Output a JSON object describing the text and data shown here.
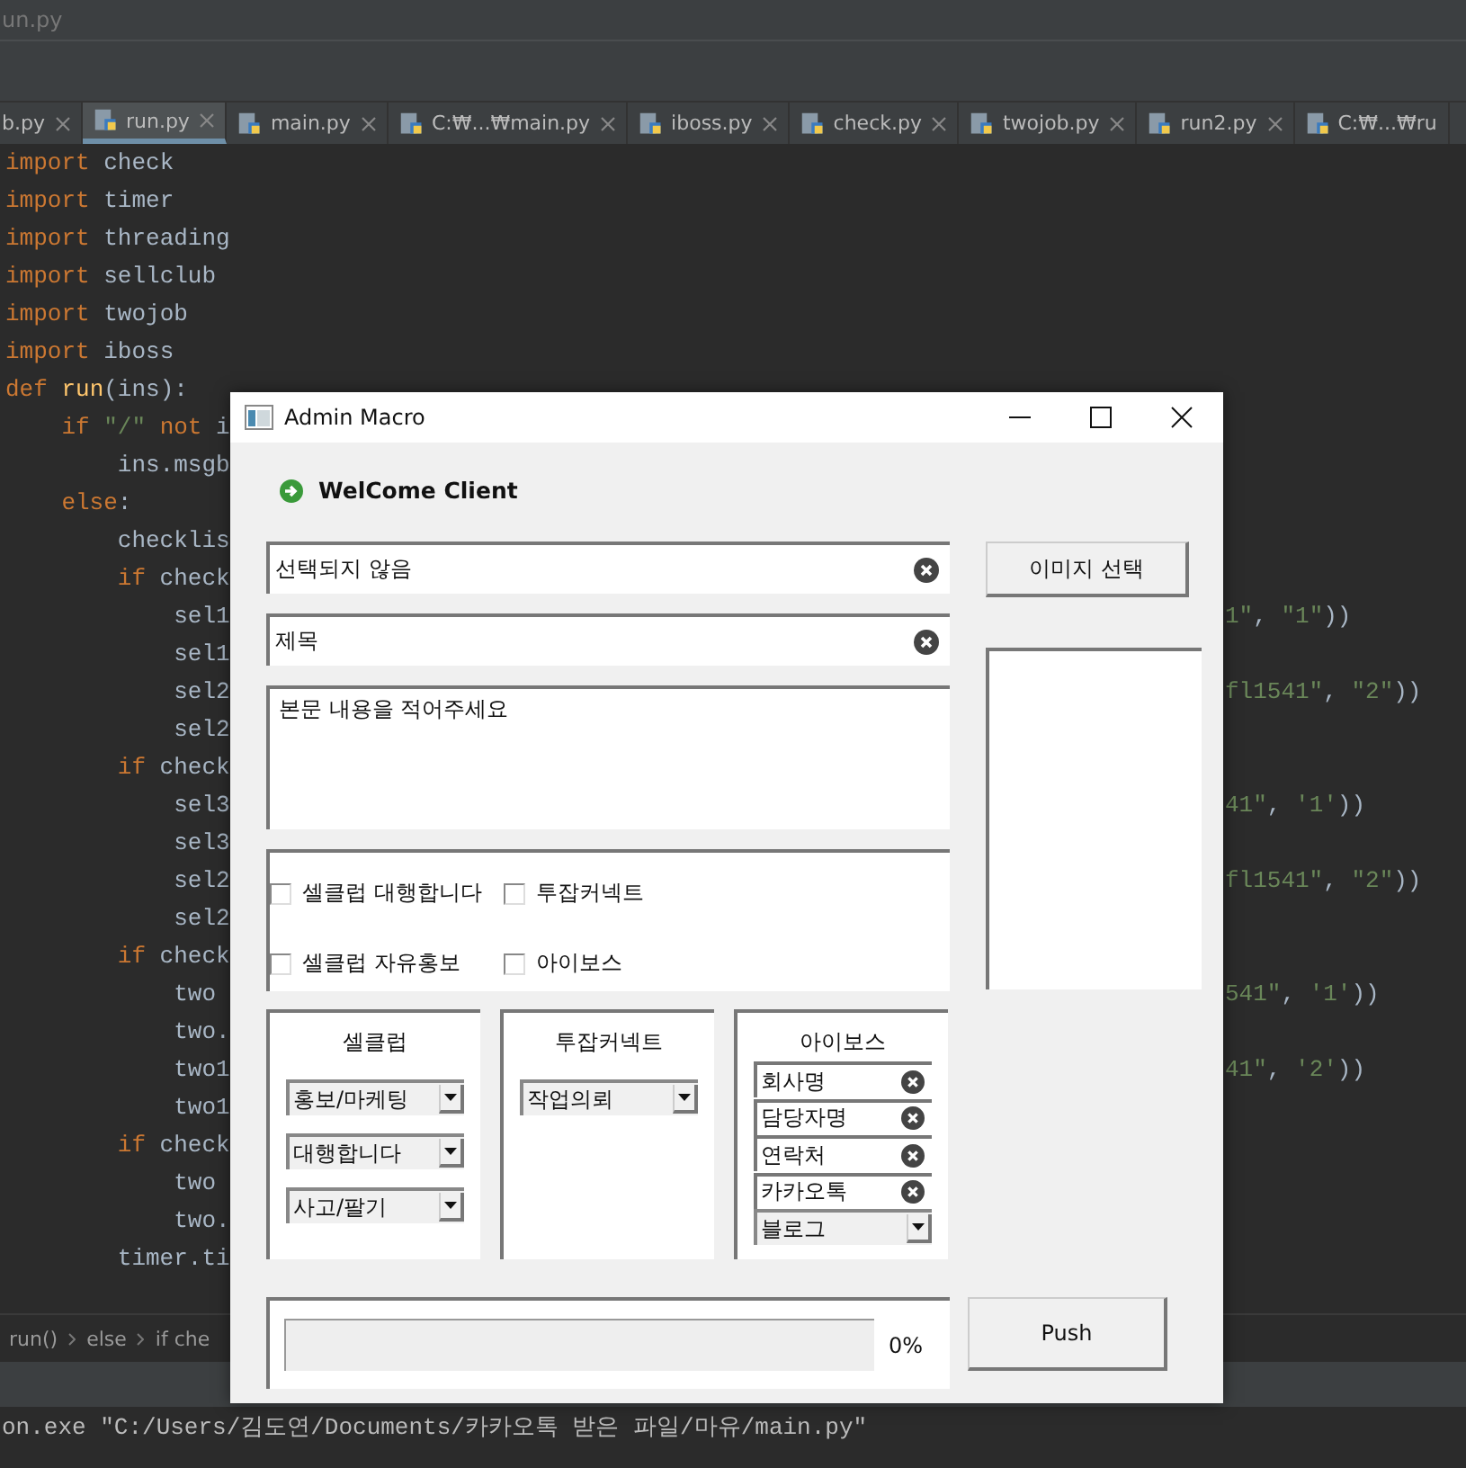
{
  "ide": {
    "title": "un.py",
    "tabs": [
      {
        "label": "b.py",
        "selected": false,
        "closable": true
      },
      {
        "label": "run.py",
        "selected": true,
        "closable": true
      },
      {
        "label": "main.py",
        "selected": false,
        "closable": true
      },
      {
        "label": "C:₩...₩main.py",
        "selected": false,
        "closable": true
      },
      {
        "label": "iboss.py",
        "selected": false,
        "closable": true
      },
      {
        "label": "check.py",
        "selected": false,
        "closable": true
      },
      {
        "label": "twojob.py",
        "selected": false,
        "closable": true
      },
      {
        "label": "run2.py",
        "selected": false,
        "closable": true
      },
      {
        "label": "C:₩...₩ru",
        "selected": false,
        "closable": false
      }
    ],
    "code": [
      {
        "left": [
          {
            "kind": "kw",
            "text": "import "
          },
          {
            "kind": "plain",
            "text": "check"
          }
        ]
      },
      {
        "left": [
          {
            "kind": "kw",
            "text": "import "
          },
          {
            "kind": "plain",
            "text": "timer"
          }
        ]
      },
      {
        "left": [
          {
            "kind": "kw",
            "text": "import "
          },
          {
            "kind": "plain",
            "text": "threading"
          }
        ]
      },
      {
        "left": [
          {
            "kind": "kw",
            "text": "import "
          },
          {
            "kind": "plain",
            "text": "sellclub"
          }
        ]
      },
      {
        "left": [
          {
            "kind": "kw",
            "text": "import "
          },
          {
            "kind": "plain",
            "text": "twojob"
          }
        ]
      },
      {
        "left": [
          {
            "kind": "kw",
            "text": "import "
          },
          {
            "kind": "plain",
            "text": "iboss"
          }
        ]
      },
      {
        "left": [
          {
            "kind": "kw",
            "text": "def "
          },
          {
            "kind": "fn",
            "text": "run"
          },
          {
            "kind": "plain",
            "text": "(ins):"
          }
        ]
      },
      {
        "left": [
          {
            "kind": "kw",
            "text": "    if "
          },
          {
            "kind": "str",
            "text": "\"/\" "
          },
          {
            "kind": "kw",
            "text": "not "
          },
          {
            "kind": "plain",
            "text": "i"
          }
        ]
      },
      {
        "left": [
          {
            "kind": "plain",
            "text": "        ins.msgb"
          }
        ]
      },
      {
        "left": [
          {
            "kind": "kw",
            "text": "    else"
          },
          {
            "kind": "plain",
            "text": ":"
          }
        ]
      },
      {
        "left": [
          {
            "kind": "plain",
            "text": "        checklis"
          }
        ]
      },
      {
        "left": [
          {
            "kind": "kw",
            "text": "        if "
          },
          {
            "kind": "plain",
            "text": "check"
          }
        ]
      },
      {
        "left": [
          {
            "kind": "plain",
            "text": "            sel1"
          }
        ],
        "right": [
          {
            "kind": "str",
            "text": "1\""
          },
          {
            "kind": "plain",
            "text": ", "
          },
          {
            "kind": "str",
            "text": "\"1\""
          },
          {
            "kind": "plain",
            "text": "))"
          }
        ]
      },
      {
        "left": [
          {
            "kind": "plain",
            "text": "            sel1"
          }
        ]
      },
      {
        "left": [
          {
            "kind": "plain",
            "text": "            sel2"
          }
        ],
        "right": [
          {
            "kind": "str",
            "text": "fl1541\""
          },
          {
            "kind": "plain",
            "text": ", "
          },
          {
            "kind": "str",
            "text": "\"2\""
          },
          {
            "kind": "plain",
            "text": "))"
          }
        ]
      },
      {
        "left": [
          {
            "kind": "plain",
            "text": "            sel2"
          }
        ]
      },
      {
        "left": [
          {
            "kind": "kw",
            "text": "        if "
          },
          {
            "kind": "plain",
            "text": "check"
          }
        ]
      },
      {
        "left": [
          {
            "kind": "plain",
            "text": "            sel3"
          }
        ],
        "right": [
          {
            "kind": "str",
            "text": "41\""
          },
          {
            "kind": "plain",
            "text": ", "
          },
          {
            "kind": "str",
            "text": "'1'"
          },
          {
            "kind": "plain",
            "text": "))"
          }
        ]
      },
      {
        "left": [
          {
            "kind": "plain",
            "text": "            sel3"
          }
        ]
      },
      {
        "left": [
          {
            "kind": "plain",
            "text": "            sel2"
          }
        ],
        "right": [
          {
            "kind": "str",
            "text": "fl1541\""
          },
          {
            "kind": "plain",
            "text": ", "
          },
          {
            "kind": "str",
            "text": "\"2\""
          },
          {
            "kind": "plain",
            "text": "))"
          }
        ]
      },
      {
        "left": [
          {
            "kind": "plain",
            "text": "            sel2"
          }
        ]
      },
      {
        "left": [
          {
            "kind": "kw",
            "text": "        if "
          },
          {
            "kind": "plain",
            "text": "check"
          }
        ]
      },
      {
        "left": [
          {
            "kind": "plain",
            "text": "            two"
          }
        ],
        "right": [
          {
            "kind": "str",
            "text": "541\""
          },
          {
            "kind": "plain",
            "text": ", "
          },
          {
            "kind": "str",
            "text": "'1'"
          },
          {
            "kind": "plain",
            "text": "))"
          }
        ]
      },
      {
        "left": [
          {
            "kind": "plain",
            "text": "            two."
          }
        ]
      },
      {
        "left": [
          {
            "kind": "plain",
            "text": "            two1"
          }
        ],
        "right": [
          {
            "kind": "str",
            "text": "41\""
          },
          {
            "kind": "plain",
            "text": ", "
          },
          {
            "kind": "str",
            "text": "'2'"
          },
          {
            "kind": "plain",
            "text": "))"
          }
        ]
      },
      {
        "left": [
          {
            "kind": "plain",
            "text": "            two1"
          }
        ]
      },
      {
        "left": [
          {
            "kind": "kw",
            "text": "        if "
          },
          {
            "kind": "plain",
            "text": "check"
          }
        ]
      },
      {
        "left": [
          {
            "kind": "plain",
            "text": "            two"
          }
        ]
      },
      {
        "left": [
          {
            "kind": "plain",
            "text": "            two."
          }
        ]
      },
      {
        "left": [
          {
            "kind": "plain",
            "text": "        timer.ti"
          }
        ]
      }
    ],
    "breadcrumb": [
      "run()",
      "else",
      "if che"
    ],
    "terminal": "on.exe \"C:/Users/김도연/Documents/카카오톡 받은 파일/마유/main.py\""
  },
  "dialog": {
    "title": "Admin Macro",
    "welcome": "WelCome Client",
    "file_field": {
      "value": "선택되지 않음"
    },
    "title_field": {
      "value": "제목"
    },
    "body_field": {
      "value": "본문 내용을 적어주세요"
    },
    "image_button": "이미지 선택",
    "checkboxes": [
      {
        "label": "셀클럽 대행합니다",
        "checked": false
      },
      {
        "label": "투잡커넥트",
        "checked": false
      },
      {
        "label": "셀클럽 자유홍보",
        "checked": false
      },
      {
        "label": "아이보스",
        "checked": false
      }
    ],
    "panels": [
      {
        "title": "셀클럽",
        "items": [
          {
            "kind": "combo",
            "value": "홍보/마케팅"
          },
          {
            "kind": "combo",
            "value": "대행합니다"
          },
          {
            "kind": "combo",
            "value": "사고/팔기"
          }
        ]
      },
      {
        "title": "투잡커넥트",
        "items": [
          {
            "kind": "combo",
            "value": "작업의뢰"
          }
        ]
      },
      {
        "title": "아이보스",
        "items": [
          {
            "kind": "field",
            "value": "회사명"
          },
          {
            "kind": "field",
            "value": "담당자명"
          },
          {
            "kind": "field",
            "value": "연락처"
          },
          {
            "kind": "field",
            "value": "카카오톡"
          },
          {
            "kind": "combo",
            "value": "블로그"
          }
        ]
      }
    ],
    "progress": {
      "level": 0,
      "reading": "0%"
    },
    "push_button": "Push"
  }
}
